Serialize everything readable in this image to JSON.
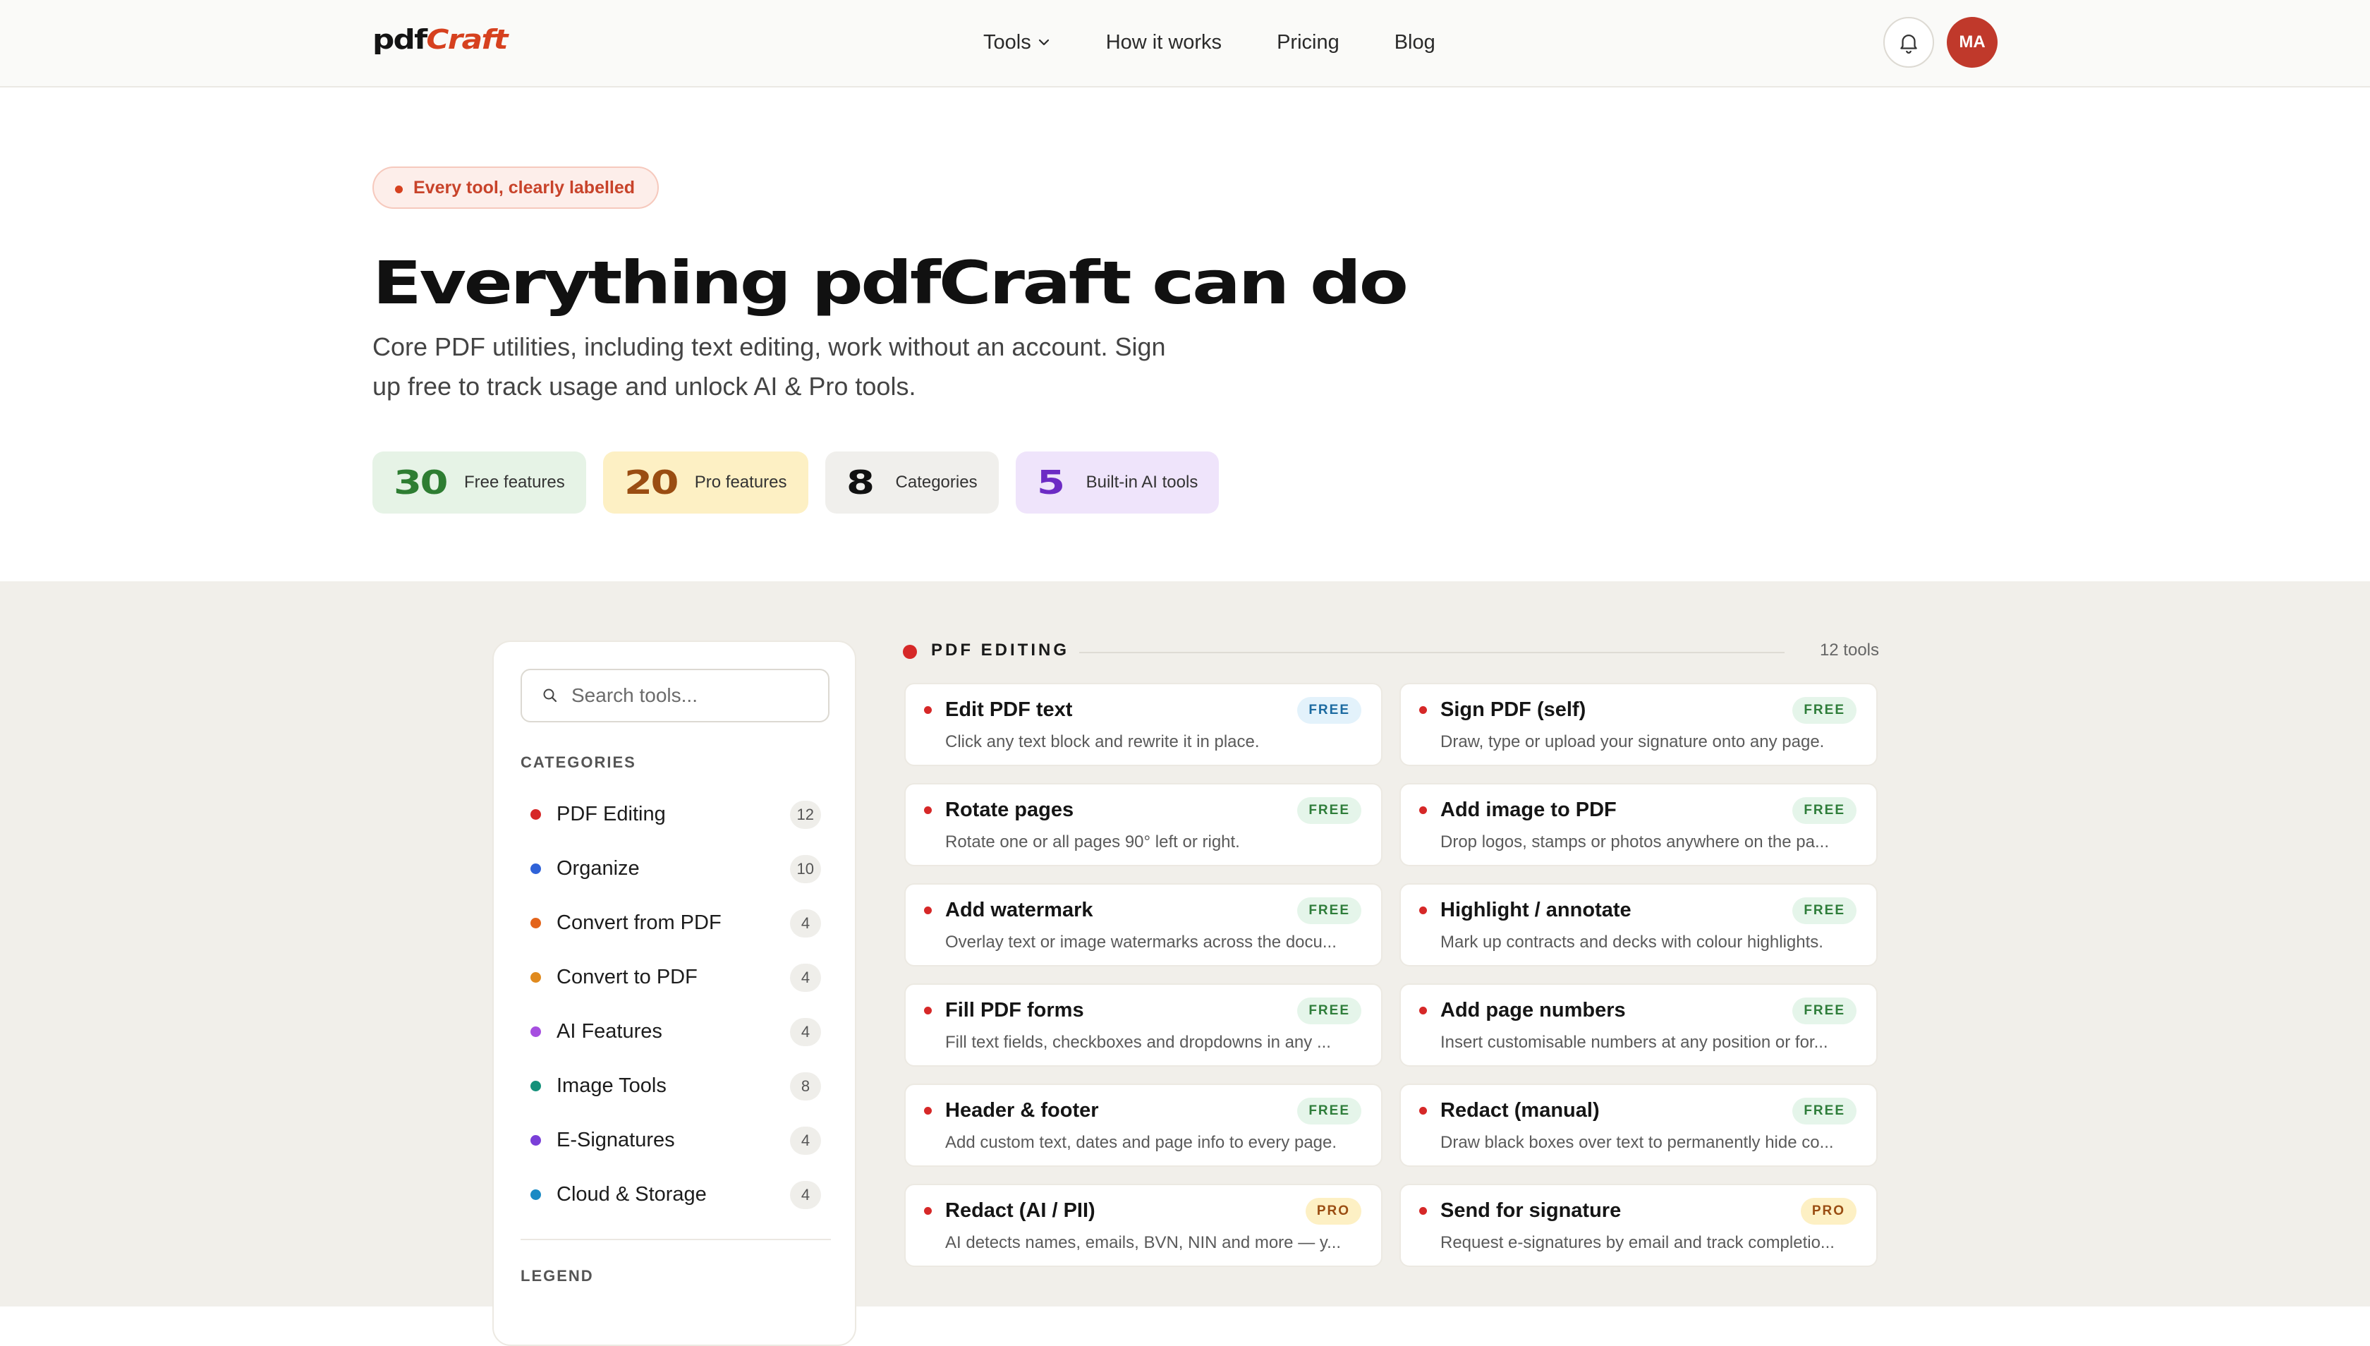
{
  "header": {
    "logo_main": "pdf",
    "logo_accent": "Craft",
    "nav": [
      {
        "label": "Tools",
        "has_dropdown": true
      },
      {
        "label": "How it works"
      },
      {
        "label": "Pricing"
      },
      {
        "label": "Blog"
      }
    ],
    "avatar_initials": "MA",
    "icons": {
      "bell": "bell-icon",
      "chevron": "chevron-down-icon"
    }
  },
  "hero": {
    "badge": "Every tool, clearly labelled",
    "title": "Everything pdfCraft can do",
    "subtitle_line1": "Core PDF utilities, including text editing, work without an account. Sign",
    "subtitle_line2": "up free to track usage and unlock AI & Pro tools.",
    "stats": [
      {
        "value": "30",
        "label": "Free features",
        "color": "#2e7d32"
      },
      {
        "value": "20",
        "label": "Pro features",
        "color": "#9a4d12"
      },
      {
        "value": "8",
        "label": "Categories",
        "color": "#111111"
      },
      {
        "value": "5",
        "label": "Built-in AI tools",
        "color": "#6c2bc4"
      }
    ]
  },
  "sidebar": {
    "search_placeholder": "Search tools...",
    "categories_heading": "CATEGORIES",
    "categories": [
      {
        "label": "PDF Editing",
        "count": "12",
        "color": "#d62828"
      },
      {
        "label": "Organize",
        "count": "10",
        "color": "#2f62d8"
      },
      {
        "label": "Convert from PDF",
        "count": "4",
        "color": "#e3641b"
      },
      {
        "label": "Convert to PDF",
        "count": "4",
        "color": "#e08a1e"
      },
      {
        "label": "AI Features",
        "count": "4",
        "color": "#a64ee0"
      },
      {
        "label": "Image Tools",
        "count": "8",
        "color": "#14917a"
      },
      {
        "label": "E-Signatures",
        "count": "4",
        "color": "#7a3fd8"
      },
      {
        "label": "Cloud & Storage",
        "count": "4",
        "color": "#1b8ac4"
      }
    ],
    "legend_heading": "LEGEND"
  },
  "section": {
    "title": "PDF EDITING",
    "count": "12 tools",
    "tools": [
      {
        "name": "Edit PDF text",
        "desc": "Click any text block and rewrite it in place.",
        "badge": "FREE",
        "badge_type": "free-blue"
      },
      {
        "name": "Sign PDF (self)",
        "desc": "Draw, type or upload your signature onto any page.",
        "badge": "FREE",
        "badge_type": "free"
      },
      {
        "name": "Rotate pages",
        "desc": "Rotate one or all pages 90° left or right.",
        "badge": "FREE",
        "badge_type": "free"
      },
      {
        "name": "Add image to PDF",
        "desc": "Drop logos, stamps or photos anywhere on the pa...",
        "badge": "FREE",
        "badge_type": "free"
      },
      {
        "name": "Add watermark",
        "desc": "Overlay text or image watermarks across the docu...",
        "badge": "FREE",
        "badge_type": "free"
      },
      {
        "name": "Highlight / annotate",
        "desc": "Mark up contracts and decks with colour highlights.",
        "badge": "FREE",
        "badge_type": "free"
      },
      {
        "name": "Fill PDF forms",
        "desc": "Fill text fields, checkboxes and dropdowns in any ...",
        "badge": "FREE",
        "badge_type": "free"
      },
      {
        "name": "Add page numbers",
        "desc": "Insert customisable numbers at any position or for...",
        "badge": "FREE",
        "badge_type": "free"
      },
      {
        "name": "Header & footer",
        "desc": "Add custom text, dates and page info to every page.",
        "badge": "FREE",
        "badge_type": "free"
      },
      {
        "name": "Redact (manual)",
        "desc": "Draw black boxes over text to permanently hide co...",
        "badge": "FREE",
        "badge_type": "free"
      },
      {
        "name": "Redact (AI / PII)",
        "desc": "AI detects names, emails, BVN, NIN and more — y...",
        "badge": "PRO",
        "badge_type": "pro"
      },
      {
        "name": "Send for signature",
        "desc": "Request e-signatures by email and track completio...",
        "badge": "PRO",
        "badge_type": "pro"
      }
    ]
  }
}
